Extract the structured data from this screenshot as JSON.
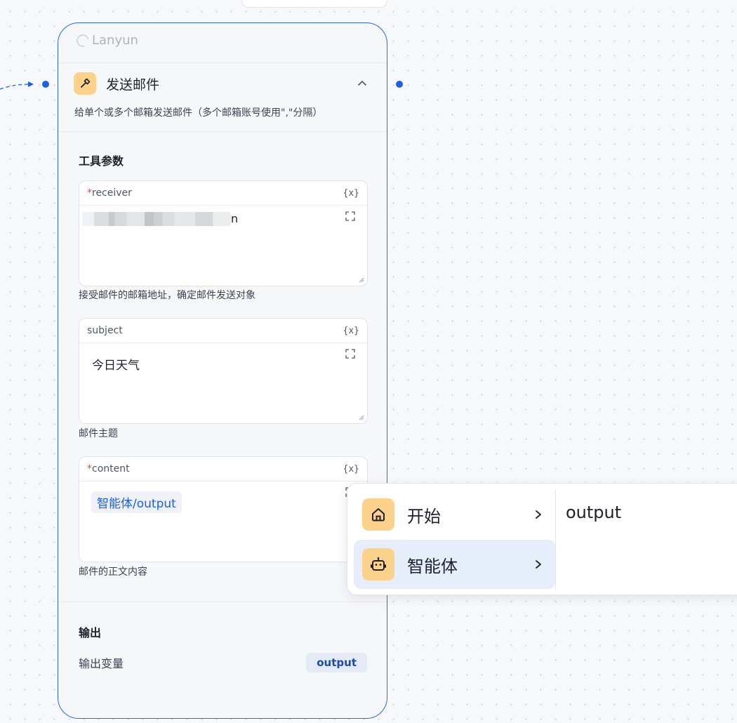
{
  "node": {
    "brand": "Lanyun",
    "title": "发送邮件",
    "description": "给单个或多个邮箱发送邮件（多个邮箱账号使用\",\"分隔）",
    "tool_params_title": "工具参数",
    "params": [
      {
        "label": "receiver",
        "required": true,
        "required_mark": "*",
        "var_icon": "{x}",
        "value": "n",
        "help": "接受邮件的邮箱地址，确定邮件发送对象"
      },
      {
        "label": "subject",
        "required": false,
        "var_icon": "{x}",
        "value": "今日天气",
        "help": "邮件主题"
      },
      {
        "label": "content",
        "required": true,
        "required_mark": "*",
        "var_icon": "{x}",
        "value_chip": "智能体/output",
        "help": "邮件的正文内容"
      }
    ],
    "output_title": "输出",
    "output_label": "输出变量",
    "output_var": "output"
  },
  "dropdown": {
    "items": [
      {
        "label": "开始",
        "icon": "home-icon",
        "active": false
      },
      {
        "label": "智能体",
        "icon": "robot-icon",
        "active": true
      }
    ],
    "sub_options": [
      "output"
    ]
  },
  "colors": {
    "accent": "#2b68e4",
    "icon_bg": "#fcd189",
    "required": "#e0443e",
    "chip_text": "#1d5fe0"
  }
}
